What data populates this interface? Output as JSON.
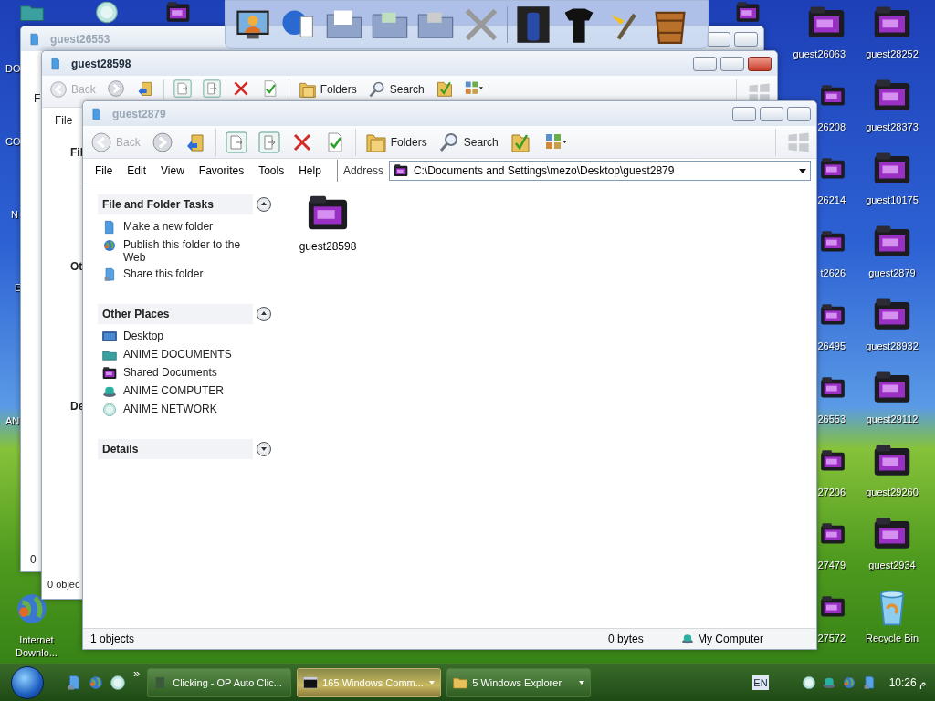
{
  "desktop": {
    "left_icons": [
      {
        "label": "DO"
      },
      {
        "label": "CO"
      },
      {
        "label": "N"
      },
      {
        "label": "E"
      },
      {
        "label": "AN"
      },
      {
        "label": "Internet Downlo..."
      }
    ],
    "right_icons_partial": [
      {
        "label": "guest26063"
      },
      {
        "label": "26208"
      },
      {
        "label": "26214"
      },
      {
        "label": "t2626"
      },
      {
        "label": "26495"
      },
      {
        "label": "26553"
      },
      {
        "label": "27206"
      },
      {
        "label": "27479"
      },
      {
        "label": "27572"
      }
    ],
    "right_icons": [
      {
        "label": "guest28252",
        "kind": "folder"
      },
      {
        "label": "guest28373",
        "kind": "folder"
      },
      {
        "label": "guest10175",
        "kind": "folder"
      },
      {
        "label": "guest2879",
        "kind": "folder"
      },
      {
        "label": "guest28932",
        "kind": "folder"
      },
      {
        "label": "guest29112",
        "kind": "folder"
      },
      {
        "label": "guest29260",
        "kind": "folder"
      },
      {
        "label": "guest2934",
        "kind": "folder"
      },
      {
        "label": "Recycle Bin",
        "kind": "recycle"
      }
    ]
  },
  "back_windows": [
    {
      "title": "guest26553",
      "active": false,
      "menu": "F",
      "status": "0"
    },
    {
      "title": "guest28598",
      "active": true,
      "toolbar": [
        {
          "kind": "back",
          "label": "Back",
          "disabled": true
        },
        {
          "kind": "forward"
        },
        {
          "kind": "up"
        },
        {
          "kind": "copy"
        },
        {
          "kind": "move"
        },
        {
          "kind": "delete"
        },
        {
          "kind": "properties"
        },
        {
          "kind": "folders",
          "label": "Folders"
        },
        {
          "kind": "search",
          "label": "Search"
        },
        {
          "kind": "folder-check"
        },
        {
          "kind": "views"
        }
      ],
      "menu": "File",
      "sections": [
        "Fil",
        "Ot",
        "De"
      ],
      "status": "0 objec"
    }
  ],
  "window": {
    "title": "guest2879",
    "active": false,
    "toolbar": [
      {
        "kind": "back",
        "label": "Back",
        "disabled": true
      },
      {
        "kind": "forward"
      },
      {
        "kind": "up"
      },
      {
        "kind": "copy"
      },
      {
        "kind": "move"
      },
      {
        "kind": "delete"
      },
      {
        "kind": "properties"
      },
      {
        "kind": "folders",
        "label": "Folders"
      },
      {
        "kind": "search",
        "label": "Search"
      },
      {
        "kind": "folder-check"
      },
      {
        "kind": "views"
      }
    ],
    "menu": [
      "File",
      "Edit",
      "View",
      "Favorites",
      "Tools",
      "Help"
    ],
    "address": {
      "label": "Address",
      "value": "C:\\Documents and Settings\\mezo\\Desktop\\guest2879"
    },
    "panels": [
      {
        "title": "File and Folder Tasks",
        "expanded": true,
        "items": [
          {
            "kind": "new-folder",
            "label": "Make a new folder"
          },
          {
            "kind": "globe",
            "label": "Publish this folder to the Web"
          },
          {
            "kind": "share",
            "label": "Share this folder"
          }
        ]
      },
      {
        "title": "Other Places",
        "expanded": true,
        "items": [
          {
            "kind": "desktop",
            "label": "Desktop"
          },
          {
            "kind": "docs",
            "label": "ANIME DOCUMENTS"
          },
          {
            "kind": "dark-folder",
            "label": "Shared Documents"
          },
          {
            "kind": "computer",
            "label": "ANIME COMPUTER"
          },
          {
            "kind": "network",
            "label": "ANIME NETWORK"
          }
        ]
      },
      {
        "title": "Details",
        "expanded": false
      }
    ],
    "files": [
      {
        "label": "guest28598"
      }
    ],
    "status": {
      "objects": "1 objects",
      "size": "0 bytes",
      "zone": "My Computer"
    }
  },
  "taskbar": {
    "more": "»",
    "tasks": [
      {
        "kind": "app",
        "label": "Clicking - OP Auto Clic...",
        "selected": false
      },
      {
        "kind": "console",
        "label": "165 Windows Comm...",
        "selected": true
      },
      {
        "kind": "folder",
        "label": "5 Windows Explorer",
        "selected": false
      }
    ],
    "language": "EN",
    "clock": "10:26 م"
  }
}
